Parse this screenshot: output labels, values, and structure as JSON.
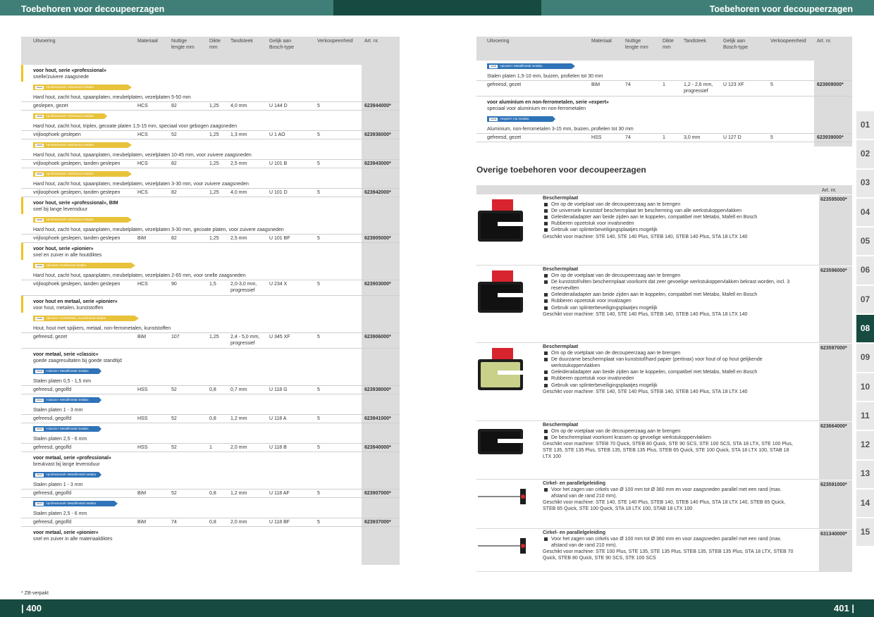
{
  "header": {
    "title_left": "Toebehoren voor decoupeerzagen",
    "title_right": "Toebehoren voor decoupeerzagen"
  },
  "footer": {
    "page_left": "| 400",
    "page_right": "401 |",
    "note": "* ZB-verpakt"
  },
  "columns": {
    "uitvoering": "Uitvoering",
    "materiaal": "Materiaal",
    "lengte": "Nuttige lengte mm",
    "dikte": "Dikte mm",
    "tandsteek": "Tandsteek",
    "bosch": "Gelijk aan Bosch-type",
    "verkoop": "Verkoopeenheid",
    "art": "Art. nr."
  },
  "left_table": [
    {
      "type": "group",
      "title": "voor hout, serie «professional»",
      "sub": "snelle/zuivere zaagsnede",
      "hl": true
    },
    {
      "type": "blade",
      "color": "#e8c23a",
      "text": ">professional< Holz/wood  metabo",
      "code": "23944",
      "w": 140
    },
    {
      "type": "desc",
      "text": "Hard hout, zacht hout, spaanplaten, meubelplaten, vezelplaten 5-50 mm"
    },
    {
      "type": "data",
      "uitv": "geslepen, gezet",
      "mat": "HCS",
      "len": "82",
      "dik": "1,25",
      "tand": "4,0 mm",
      "bosch": "U 144 D",
      "ve": "5",
      "art": "623944000*"
    },
    {
      "type": "blade",
      "color": "#e8c23a",
      "text": ">professional< Holz/wood  metabo",
      "code": "23936",
      "w": 105
    },
    {
      "type": "desc",
      "text": "Hard hout, zacht hout, triplex, gecoate platen 1,5-15 mm, speciaal voor gebogen zaagsneden"
    },
    {
      "type": "data",
      "uitv": "vrijloophoek geslepen",
      "mat": "HCS",
      "len": "52",
      "dik": "1,25",
      "tand": "1,3 mm",
      "bosch": "U 1 AO",
      "ve": "5",
      "art": "623936000*"
    },
    {
      "type": "blade",
      "color": "#e8c23a",
      "text": ">professional< Holz/wood  metabo",
      "code": "23943",
      "w": 140
    },
    {
      "type": "desc",
      "text": "Hard hout, zacht hout, spaanplaten, meubelplaten, vezelplaten 10-45 mm, voor zuivere zaagsneden"
    },
    {
      "type": "data",
      "uitv": "vrijloophoek geslepen, tanden geslepen",
      "mat": "HCS",
      "len": "82",
      "dik": "1,25",
      "tand": "2,5 mm",
      "bosch": "U 101 B",
      "ve": "5",
      "art": "623943000*"
    },
    {
      "type": "blade",
      "color": "#e8c23a",
      "text": ">professional< Holz/wood  metabo",
      "code": "23942",
      "w": 140
    },
    {
      "type": "desc",
      "text": "Hard hout, zacht hout, spaanplaten, meubelplaten, vezelplaten 3-30 mm, voor zuivere zaagsneden"
    },
    {
      "type": "data",
      "uitv": "vrijloophoek geslepen, tanden geslepen",
      "mat": "HCS",
      "len": "82",
      "dik": "1,25",
      "tand": "4,0 mm",
      "bosch": "U 101 D",
      "ve": "5",
      "art": "623942000*"
    },
    {
      "type": "group",
      "title": "voor hout, serie «professional», BIM",
      "sub": "snel bij lange levensduur",
      "hl": true
    },
    {
      "type": "blade",
      "color": "#e8c23a",
      "text": ">professional< Holz/wood  metabo",
      "code": "23905",
      "w": 140
    },
    {
      "type": "desc",
      "text": "Hard hout, zacht hout, spaanplaten, meubelplaten, vezelplaten 3-30 mm, gecoate platen, voor zuivere zaagsneden"
    },
    {
      "type": "data",
      "uitv": "vrijloophoek geslepen, tanden geslepen",
      "mat": "BiM",
      "len": "82",
      "dik": "1,25",
      "tand": "2,5 mm",
      "bosch": "U 101 BF",
      "ve": "5",
      "art": "623905000*"
    },
    {
      "type": "group",
      "title": "voor hout, serie «pionier»",
      "sub": "snel en zuiver in alle houtdiktes",
      "hl": true
    },
    {
      "type": "blade",
      "color": "#e8c23a",
      "text": ">pionier< Holz/wood  metabo",
      "code": "23903",
      "w": 145
    },
    {
      "type": "desc",
      "text": "Hard hout, zacht hout, spaanplaten, meubelplaten, vezelplaten 2-65 mm, voor snelle zaagsneden"
    },
    {
      "type": "data2",
      "uitv": "vrijloophoek geslepen, tanden geslepen",
      "mat": "HCS",
      "len": "90",
      "dik": "1,5",
      "tand": "2,0-3,0 mm,",
      "tand2": "progressief",
      "bosch": "U 234 X",
      "ve": "5",
      "art": "623903000*"
    },
    {
      "type": "group",
      "title": "voor hout en metaal, serie «pionier«",
      "sub": "voor hout, metalen, kunststoffen",
      "hl": true
    },
    {
      "type": "blade",
      "color": "#e8c23a",
      "text": ">pionier< Holz/Metall | wood/metal  metabo",
      "code": "23906",
      "w": 150
    },
    {
      "type": "desc",
      "text": "Hout, hout met spijkers, metaal, non-ferrometalen, kunststoffen"
    },
    {
      "type": "data2",
      "uitv": "gefreesd, gezet",
      "mat": "BiM",
      "len": "107",
      "dik": "1,25",
      "tand": "2,4 - 5,0 mm,",
      "tand2": "progressief",
      "bosch": "U 345 XF",
      "ve": "5",
      "art": "623906000*"
    },
    {
      "type": "group",
      "title": "voor metaal, serie «classic«",
      "sub": "goede zaagresultaten bij goede standtijd",
      "hl": false
    },
    {
      "type": "blade",
      "color": "#2f73b8",
      "text": ">classic< Metall/metal  metabo",
      "code": "23938",
      "w": 97
    },
    {
      "type": "desc",
      "text": "Stalen platen 0,5 - 1,5 mm"
    },
    {
      "type": "data",
      "uitv": "gefreesd, gegolfd",
      "mat": "HSS",
      "len": "52",
      "dik": "0,8",
      "tand": "0,7 mm",
      "bosch": "U 118 G",
      "ve": "5",
      "art": "623938000*"
    },
    {
      "type": "blade",
      "color": "#2f73b8",
      "text": ">classic< Metall/metal  metabo",
      "code": "23941",
      "w": 97
    },
    {
      "type": "desc",
      "text": "Stalen platen 1 - 3 mm"
    },
    {
      "type": "data",
      "uitv": "gefreesd, gegolfd",
      "mat": "HSS",
      "len": "52",
      "dik": "0,8",
      "tand": "1,2 mm",
      "bosch": "U 118 A",
      "ve": "5",
      "art": "623941000*"
    },
    {
      "type": "blade",
      "color": "#2f73b8",
      "text": ">classic< Metall/metal  metabo",
      "code": "23940",
      "w": 97
    },
    {
      "type": "desc",
      "text": "Stalen platen 2,5 - 6 mm"
    },
    {
      "type": "data",
      "uitv": "gefreesd, gegolfd",
      "mat": "HSS",
      "len": "52",
      "dik": "1",
      "tand": "2,0 mm",
      "bosch": "U 118 B",
      "ve": "5",
      "art": "623940000*"
    },
    {
      "type": "group",
      "title": "voor metaal, serie «professional«",
      "sub": "breukvast bij lange levensduur",
      "hl": false
    },
    {
      "type": "blade",
      "color": "#2f73b8",
      "text": ">professional< Metall/metal  metabo",
      "code": "23907",
      "w": 97
    },
    {
      "type": "desc",
      "text": "Stalen platen 1 - 3 mm"
    },
    {
      "type": "data",
      "uitv": "gefreesd, gegolfd",
      "mat": "BiM",
      "len": "52",
      "dik": "0,8",
      "tand": "1,2 mm",
      "bosch": "U 118 AF",
      "ve": "5",
      "art": "623907000*"
    },
    {
      "type": "blade",
      "color": "#2f73b8",
      "text": ">professional< Metall/metal  metabo",
      "code": "23937",
      "w": 120
    },
    {
      "type": "desc",
      "text": "Stalen platen 2,5 - 6 mm"
    },
    {
      "type": "data",
      "uitv": "gefreesd, gegolfd",
      "mat": "BiM",
      "len": "74",
      "dik": "0,8",
      "tand": "2,0 mm",
      "bosch": "U 118 BF",
      "ve": "5",
      "art": "623937000*"
    },
    {
      "type": "group",
      "title": "voor metaal, serie «pionier«",
      "sub": "snel en zuiver in alle materiaaldiktes",
      "hl": false
    }
  ],
  "right_table": [
    {
      "type": "blade",
      "color": "#2f73b8",
      "text": ">pionier< Metall/metal  metabo",
      "code": "23909",
      "w": 125
    },
    {
      "type": "desc",
      "text": "Stalen platen 1,5-10 mm, buizen, profielen tot 30 mm"
    },
    {
      "type": "data2",
      "uitv": "gefreesd, gezet",
      "mat": "BiM",
      "len": "74",
      "dik": "1",
      "tand": "1,2 - 2,6 mm,",
      "tand2": "progressief",
      "bosch": "U 123 XF",
      "ve": "5",
      "art": "623909000*"
    },
    {
      "type": "group",
      "title": "voor aluminium en non-ferrometalen, serie «expert»",
      "sub": "speciaal voor aluminium en non-ferrometalen",
      "hl": false
    },
    {
      "type": "blade",
      "color": "#2f73b8",
      "text": ">expert< Alu  metabo",
      "code": "23939",
      "w": 97
    },
    {
      "type": "desc",
      "text": "Aluminium, non-ferrometalen 3-15 mm, buizen, profielen tot 30 mm"
    },
    {
      "type": "data",
      "uitv": "gefreesd, gezet",
      "mat": "HSS",
      "len": "74",
      "dik": "1",
      "tand": "3,0 mm",
      "bosch": "U 127 D",
      "ve": "5",
      "art": "623939000*"
    }
  ],
  "overige": {
    "title": "Overige toebehoren voor decoupeerzagen",
    "art_header": "Art. nr.",
    "items": [
      {
        "name": "Beschermplaat",
        "bullets": [
          "Om op de voetplaat van de decoupeerzaag aan te brengen",
          "De universele kunststof beschermplaat ter bescherming van alle werkstukoppervlakken",
          "Geleiderailadapter aan beide zijden aan te koppelen, compatibel met Metabo, Mafell en Bosch",
          "Rubberen opzetstuk voor invalsneden",
          "Gebruik van splinterbeveiligingsplaatjes mogelijk"
        ],
        "fit": "Geschikt voor machine: STE 140, STE 140 Plus, STEB 140, STEB 140 Plus, STA 18 LTX 140",
        "art": "623595000*"
      },
      {
        "name": "Beschermplaat",
        "bullets": [
          "Om op de voetplaat van de decoupeerzaag aan te brengen",
          "De kunststof/vilten beschermplaat voorkomt dat zeer gevoelige werkstukoppervlakken bekrast worden, incl. 3 reservevilten",
          "Geleiderailadapter aan beide zijden aan te koppelen, compatibel met Metabo, Mafell en Bosch",
          "Rubberen opzetstuk voor invalzagen",
          "Gebruik van splinterbeveiligingsplaatjes mogelijk"
        ],
        "fit": "Geschikt voor machine: STE 140, STE 140 Plus, STEB 140, STEB 140 Plus, STA 18 LTX 140",
        "art": "623596000*"
      },
      {
        "name": "Beschermplaat",
        "bullets": [
          "Om op de voetplaat van de decoupeerzaag aan te brengen",
          "De duurzame beschermplaat van kunststof/hard papier (pertinax) voor hout of op hout gelijkende werkstukoppervlakken",
          "Geleiderailadapter aan beide zijden aan te koppelen, compatibel met Metabo, Mafell en Bosch",
          "Rubberen opzetstuk voor invalsneden",
          "Gebruik van splinterbeveiligingsplaatjes mogelijk"
        ],
        "fit": "Geschikt voor machine: STE 140, STE 140 Plus, STEB 140, STEB 140 Plus, STA 18 LTX 140",
        "art": "623597000*"
      },
      {
        "name": "Beschermplaat",
        "bullets": [
          "Om op de voetplaat van de decoupeerzaag aan te brengen",
          "De beschermplaat voorkomt krassen op gevoelige werkstukoppervlakken"
        ],
        "fit": "Geschikt voor machine: STEB 70 Quick, STEB 80 Quick, STE 90 SCS, STE 100 SCS, STA 18 LTX, STE 100 Plus, STE 135, STE 135 Plus, STEB 135, STEB 135 Plus, STEB 65 Quick, STE 100 Quick, STA 18 LTX 100, STAB 18 LTX 100",
        "art": "623664000*"
      },
      {
        "name": "Cirkel- en parallelgeleiding",
        "bullets": [
          "Voor het zagen van cirkels van Ø 100 mm tot Ø 360 mm en voor zaagsneden parallel met een rand (max. afstand van de rand 210 mm)."
        ],
        "fit": "Geschikt voor machine: STE 140, STE 140 Plus, STEB 140, STEB 140 Plus, STA 18 LTX 140, STEB 65 Quick, STEB 65 Quick, STE 100 Quick, STA 18 LTX 100, STAB 18 LTX 100",
        "art": "623591000*"
      },
      {
        "name": "Cirkel- en parallelgeleiding",
        "bullets": [
          "Voor het zagen van cirkels van Ø 100 mm tot Ø 360 mm en voor zaagsneden parallel met een rand (max. afstand van de rand 210 mm)."
        ],
        "fit": "Geschikt voor machine: STE 100 Plus, STE 135, STE 135 Plus, STEB 135, STEB 135 Plus, STA 18 LTX, STEB 70 Quick, STEB 80 Quick, STE 90 SCS, STE 100 SCS",
        "art": "631340000*"
      }
    ]
  },
  "tabs": [
    "01",
    "02",
    "03",
    "04",
    "05",
    "06",
    "07",
    "08",
    "09",
    "10",
    "11",
    "12",
    "13",
    "14",
    "15"
  ],
  "active_tab": "08"
}
